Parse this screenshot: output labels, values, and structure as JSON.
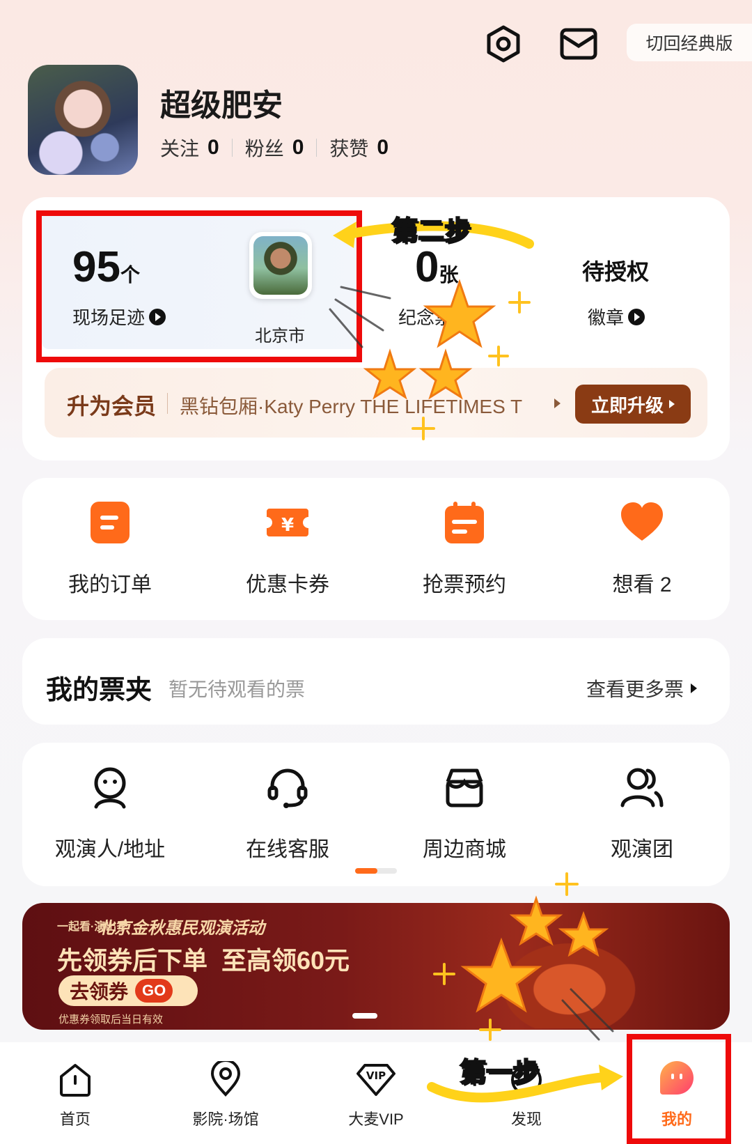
{
  "header": {
    "classic_label": "切回经典版",
    "icons": [
      "settings-icon",
      "mail-icon"
    ]
  },
  "profile": {
    "username": "超级肥安",
    "follow_label": "关注",
    "follow_count": "0",
    "fans_label": "粉丝",
    "fans_count": "0",
    "likes_label": "获赞",
    "likes_count": "0"
  },
  "stats_card": {
    "footprints": {
      "value": "95",
      "unit": "个",
      "label": "现场足迹"
    },
    "city": "北京市",
    "souvenir": {
      "value": "0",
      "unit": "张",
      "label": "纪念票"
    },
    "badge": {
      "value": "待授权",
      "label": "徽章"
    }
  },
  "membership": {
    "title": "升为会员",
    "promo": "黑钻包厢·Katy Perry THE LIFETIMES T",
    "upgrade_label": "立即升级"
  },
  "quick_actions": [
    {
      "label": "我的订单",
      "icon": "order-icon"
    },
    {
      "label": "优惠卡券",
      "icon": "coupon-icon"
    },
    {
      "label": "抢票预约",
      "icon": "calendar-icon"
    },
    {
      "label": "想看 2",
      "icon": "heart-icon"
    }
  ],
  "tickets": {
    "title": "我的票夹",
    "empty_text": "暂无待观看的票",
    "more_label": "查看更多票"
  },
  "services": [
    {
      "label": "观演人/地址",
      "icon": "viewer-icon"
    },
    {
      "label": "在线客服",
      "icon": "headset-icon"
    },
    {
      "label": "周边商城",
      "icon": "store-icon"
    },
    {
      "label": "观演团",
      "icon": "group-icon"
    }
  ],
  "banner": {
    "brand": "一起看·演出季",
    "headline": "北京金秋惠民观演活动",
    "offer": "先领券后下单  至高领60元",
    "cta": "去领券",
    "go": "GO",
    "note": "优惠券领取后当日有效"
  },
  "annotations": {
    "step_one": "第一步",
    "step_two": "第二步"
  },
  "tabbar": [
    {
      "label": "首页",
      "icon": "home-icon"
    },
    {
      "label": "影院·场馆",
      "icon": "location-icon"
    },
    {
      "label": "大麦VIP",
      "icon": "vip-icon"
    },
    {
      "label": "发现",
      "icon": "discover-icon"
    },
    {
      "label": "我的",
      "icon": "mine-icon",
      "active": true
    }
  ],
  "colors": {
    "accent": "#ff6a1a",
    "annotation_red": "#ee0a0a",
    "highlight_yellow": "#ffd21a",
    "upgrade_brown": "#8a3b14"
  }
}
